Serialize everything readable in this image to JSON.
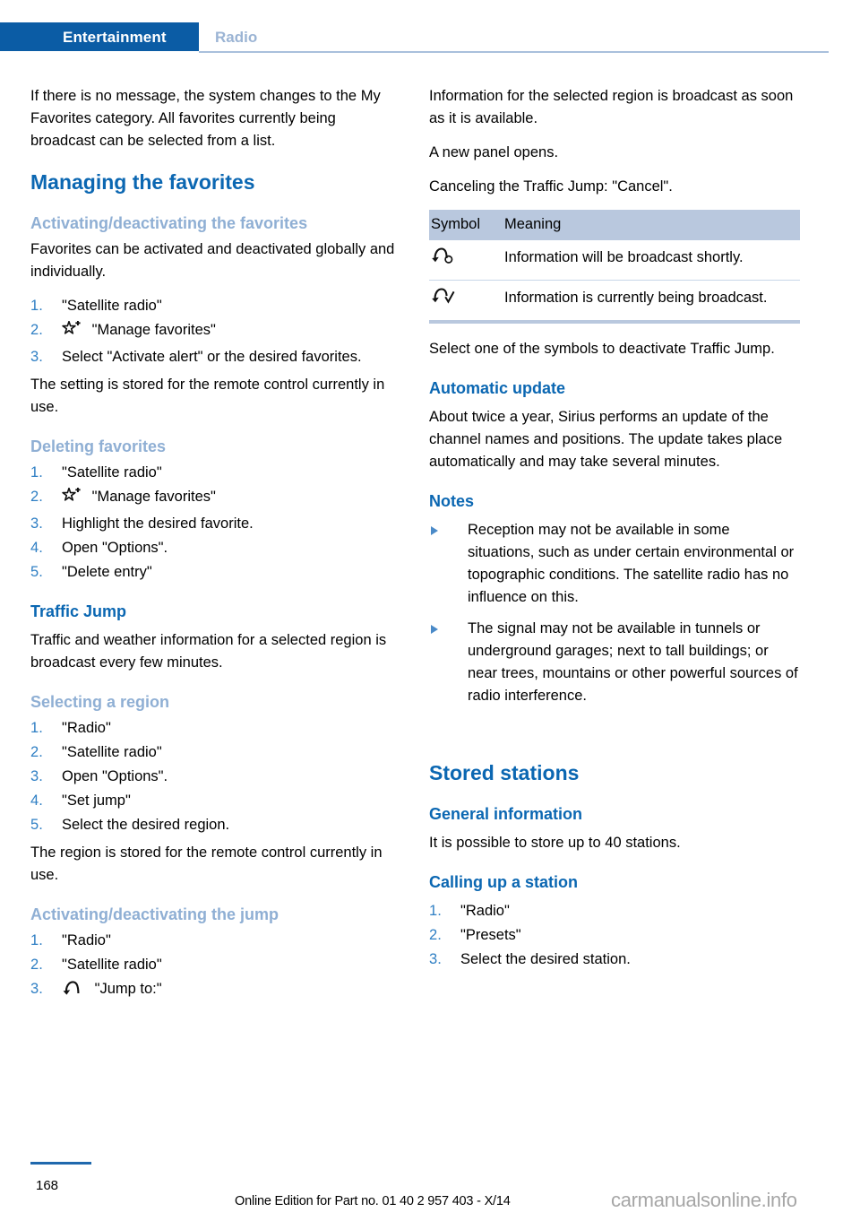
{
  "header": {
    "active_tab": "Entertainment",
    "sub_tab": "Radio",
    "accent_color": "#0b5ca5",
    "heading_color": "#0b67b2",
    "subheading_color": "#8fafd4"
  },
  "left_column": {
    "intro": "If there is no message, the system changes to the My Favorites category. All favorites currently being broadcast can be selected from a list.",
    "managing_heading": "Managing the favorites",
    "activating_subheading": "Activating/deactivating the favorites",
    "activating_intro": "Favorites can be activated and deactivated globally and individually.",
    "activating_steps": [
      {
        "text": "\"Satellite radio\"",
        "icon": ""
      },
      {
        "text": "\"Manage favorites\"",
        "icon": "star-plus-icon"
      },
      {
        "text": "Select \"Activate alert\" or the desired favorites.",
        "icon": ""
      }
    ],
    "activating_note": "The setting is stored for the remote control currently in use.",
    "deleting_subheading": "Deleting favorites",
    "deleting_steps": [
      {
        "text": "\"Satellite radio\"",
        "icon": ""
      },
      {
        "text": "\"Manage favorites\"",
        "icon": "star-plus-icon"
      },
      {
        "text": "Highlight the desired favorite.",
        "icon": ""
      },
      {
        "text": "Open \"Options\".",
        "icon": ""
      },
      {
        "text": "\"Delete entry\"",
        "icon": ""
      }
    ],
    "traffic_jump_heading": "Traffic Jump",
    "traffic_jump_intro": "Traffic and weather information for a selected region is broadcast every few minutes.",
    "selecting_region_subheading": "Selecting a region",
    "selecting_region_steps": [
      {
        "text": "\"Radio\"",
        "icon": ""
      },
      {
        "text": "\"Satellite radio\"",
        "icon": ""
      },
      {
        "text": "Open \"Options\".",
        "icon": ""
      },
      {
        "text": "\"Set jump\"",
        "icon": ""
      },
      {
        "text": "Select the desired region.",
        "icon": ""
      }
    ],
    "selecting_region_note": "The region is stored for the remote control currently in use.",
    "activating_jump_subheading": "Activating/deactivating the jump",
    "activating_jump_steps": [
      {
        "text": "\"Radio\"",
        "icon": ""
      },
      {
        "text": "\"Satellite radio\"",
        "icon": ""
      },
      {
        "text": "\"Jump to:\"",
        "icon": "jump-arc-icon"
      }
    ]
  },
  "right_column": {
    "intro_1": "Information for the selected region is broadcast as soon as it is available.",
    "intro_2": "A new panel opens.",
    "intro_3": "Canceling the Traffic Jump: \"Cancel\".",
    "table": {
      "columns": [
        "Symbol",
        "Meaning"
      ],
      "rows": [
        {
          "icon": "arc-circle-icon",
          "meaning": "Information will be broadcast shortly."
        },
        {
          "icon": "arc-check-icon",
          "meaning": "Information is currently being broadcast."
        }
      ]
    },
    "after_table": "Select one of the symbols to deactivate Traffic Jump.",
    "automatic_update_heading": "Automatic update",
    "automatic_update_text": "About twice a year, Sirius performs an update of the channel names and positions. The update takes place automatically and may take several minutes.",
    "notes_heading": "Notes",
    "notes": [
      "Reception may not be available in some situations, such as under certain environmental or topographic conditions. The satellite radio has no influence on this.",
      "The signal may not be available in tunnels or underground garages; next to tall buildings; or near trees, mountains or other powerful sources of radio interference."
    ],
    "stored_stations_heading": "Stored stations",
    "general_information_heading": "General information",
    "general_information_text": "It is possible to store up to 40 stations.",
    "calling_up_heading": "Calling up a station",
    "calling_up_steps": [
      {
        "text": "\"Radio\"",
        "icon": ""
      },
      {
        "text": "\"Presets\"",
        "icon": ""
      },
      {
        "text": "Select the desired station.",
        "icon": ""
      }
    ]
  },
  "footer": {
    "page_number": "168",
    "edition_text": "Online Edition for Part no. 01 40 2 957 403 - X/14",
    "watermark": "carmanualsonline.info"
  }
}
